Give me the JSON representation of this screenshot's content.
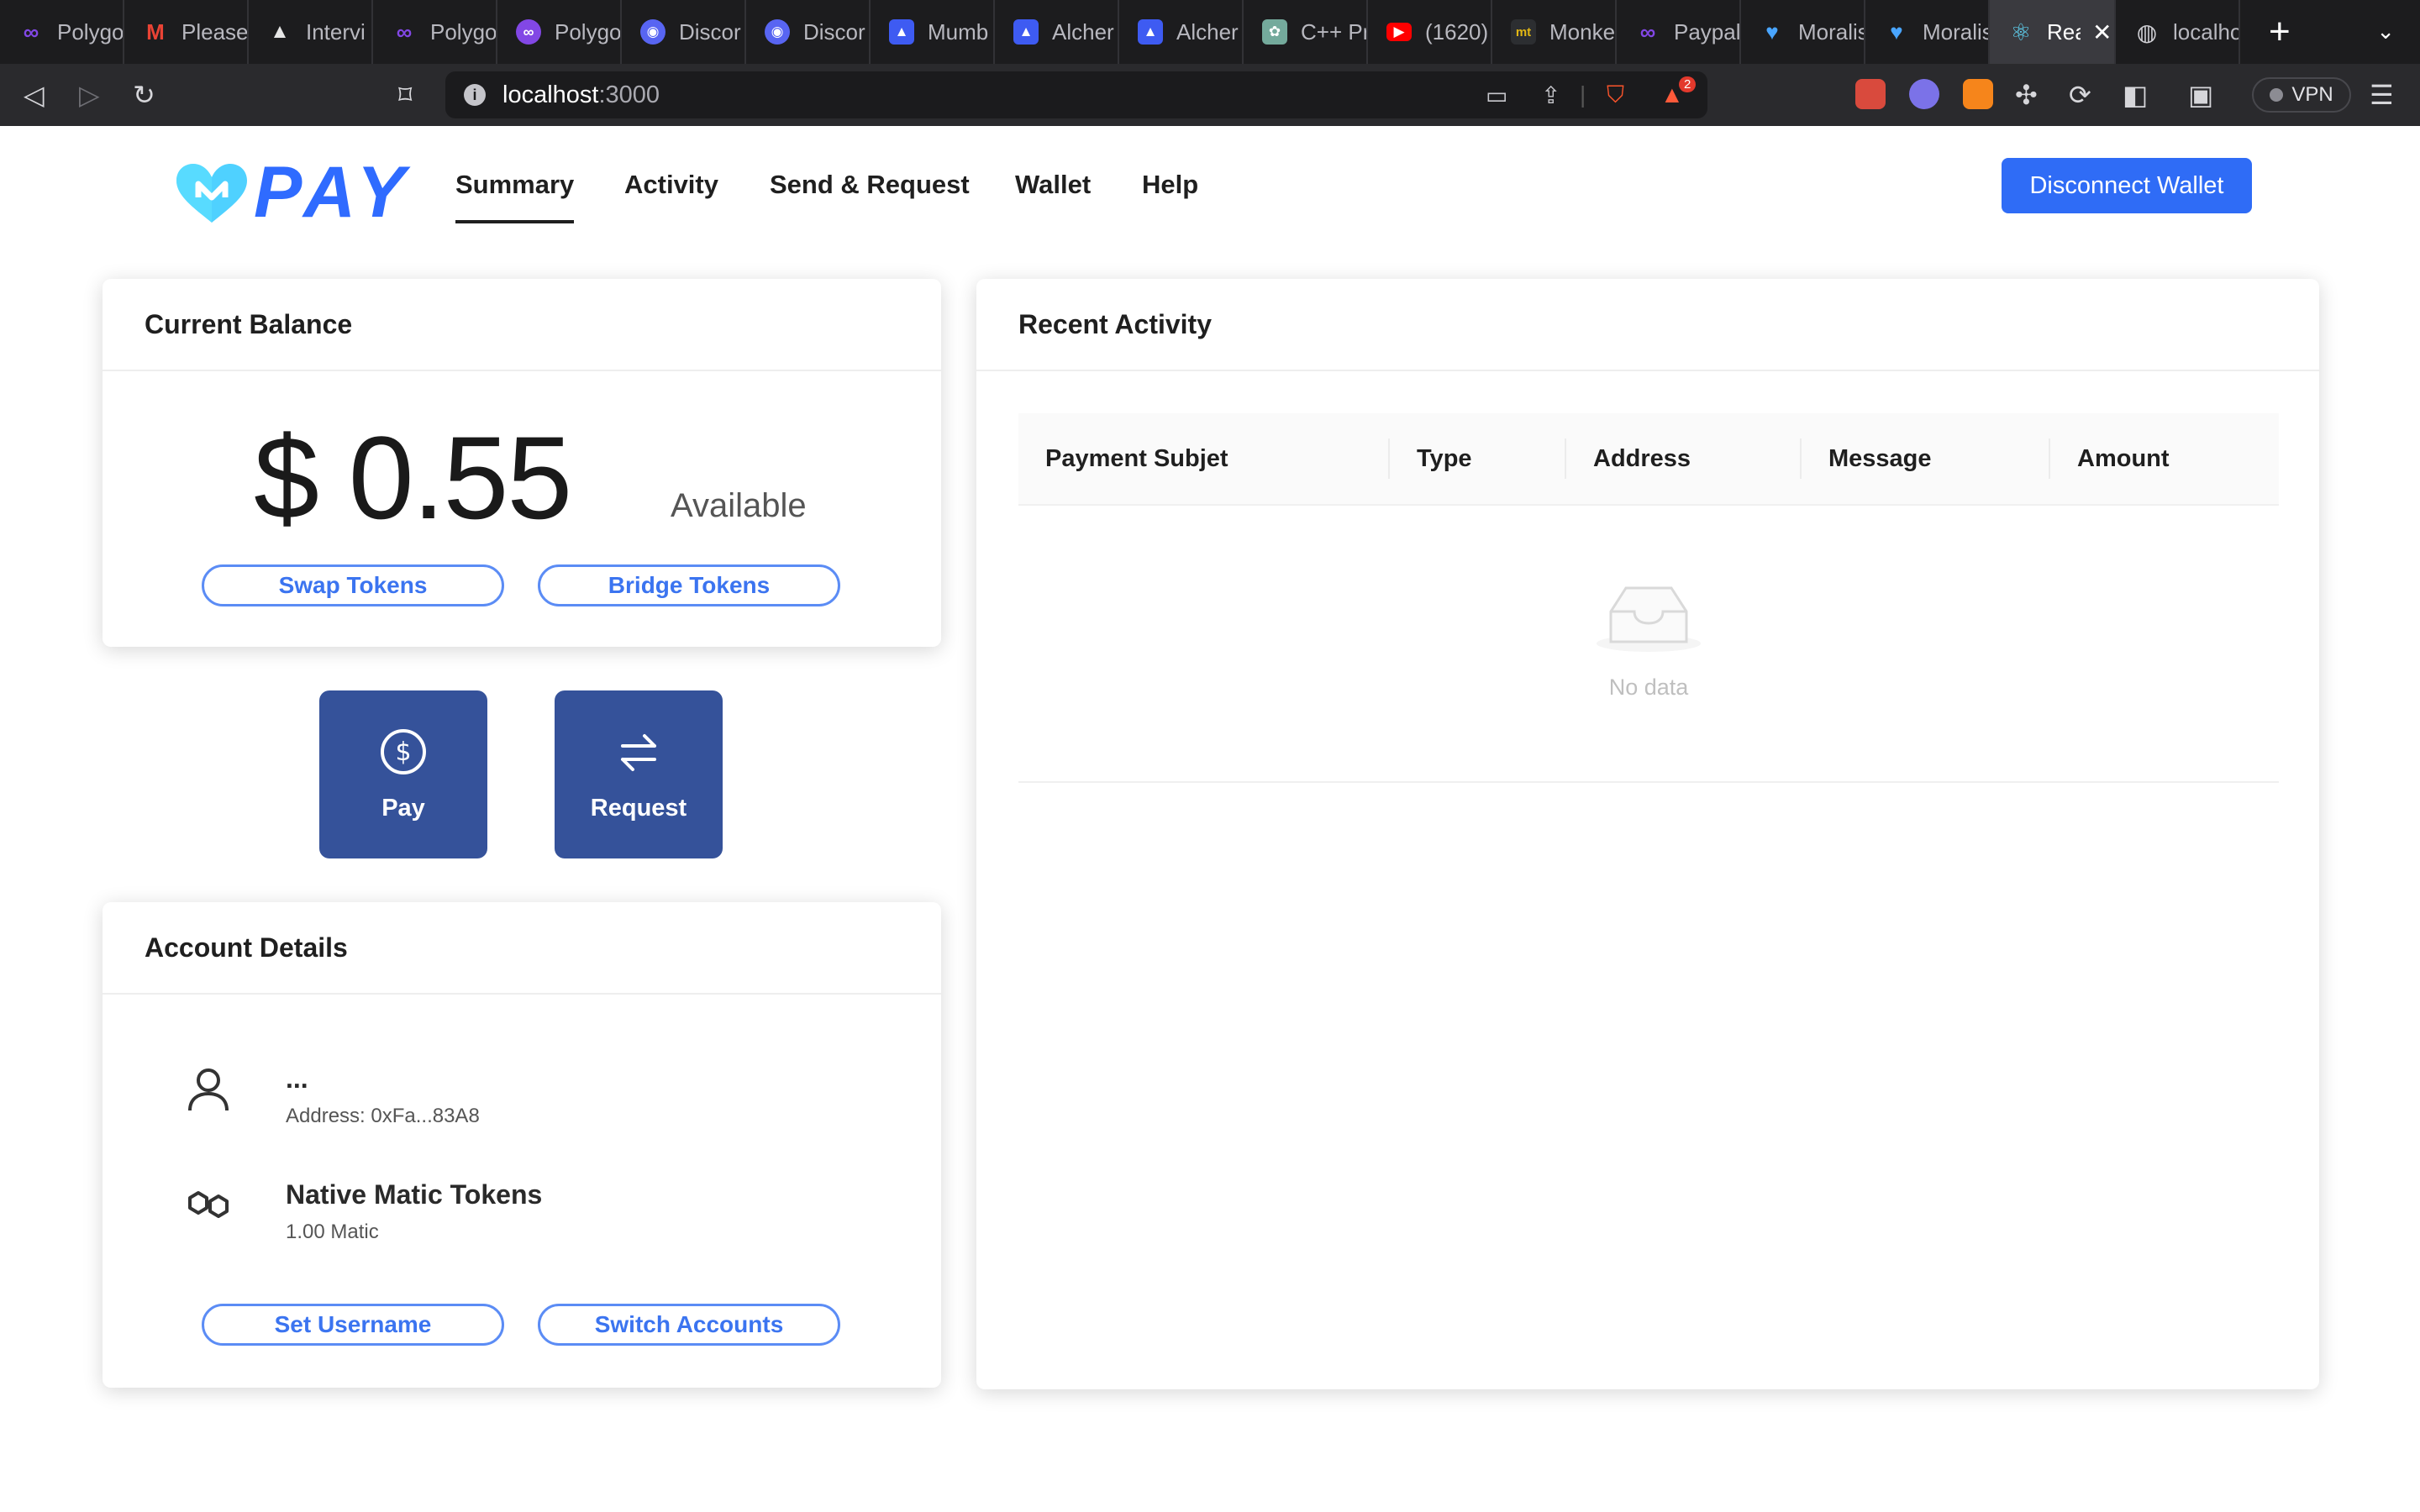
{
  "browser": {
    "tabs": [
      {
        "title": "Polygo",
        "icon": "polygon-icon",
        "color": "#8247e5"
      },
      {
        "title": "Please",
        "icon": "gmail-icon",
        "color": "#ea4335"
      },
      {
        "title": "Intervi",
        "icon": "mountain-icon",
        "color": "#e6e6e6"
      },
      {
        "title": "Polygo",
        "icon": "polygon-icon",
        "color": "#8247e5"
      },
      {
        "title": "Polygo",
        "icon": "polygon-icon",
        "color": "#8247e5"
      },
      {
        "title": "Discor",
        "icon": "discord-icon",
        "color": "#5865f2"
      },
      {
        "title": "Discor",
        "icon": "discord-icon",
        "color": "#5865f2"
      },
      {
        "title": "Mumb",
        "icon": "alchemy-icon",
        "color": "#3e5bf2"
      },
      {
        "title": "Alcher",
        "icon": "alchemy-icon",
        "color": "#3e5bf2"
      },
      {
        "title": "Alcher",
        "icon": "alchemy-icon",
        "color": "#3e5bf2"
      },
      {
        "title": "C++ Pr",
        "icon": "openai-icon",
        "color": "#74aa9c"
      },
      {
        "title": "(1620)",
        "icon": "youtube-icon",
        "color": "#ff0000"
      },
      {
        "title": "Monke",
        "icon": "monkeytype-icon",
        "color": "#2c2e31"
      },
      {
        "title": "Paypal",
        "icon": "polygon-icon",
        "color": "#8247e5"
      },
      {
        "title": "Moralis",
        "icon": "moralis-icon",
        "color": "#49a5ff"
      },
      {
        "title": "Moralis",
        "icon": "moralis-icon",
        "color": "#49a5ff"
      },
      {
        "title": "Rea",
        "icon": "react-icon",
        "color": "#61dafb",
        "active": true
      },
      {
        "title": "localho",
        "icon": "globe-icon",
        "color": "#cfcfd4"
      }
    ],
    "new_tab": "+",
    "url_host": "localhost",
    "url_port": ":3000",
    "brave_badge": "2",
    "vpn_label": "VPN"
  },
  "app": {
    "logo_text": "PAY",
    "nav": [
      "Summary",
      "Activity",
      "Send & Request",
      "Wallet",
      "Help"
    ],
    "active_nav": "Summary",
    "disconnect": "Disconnect Wallet"
  },
  "balance_card": {
    "title": "Current Balance",
    "amount": "$ 0.55",
    "available": "Available",
    "swap": "Swap Tokens",
    "bridge": "Bridge Tokens"
  },
  "actions": {
    "pay": "Pay",
    "request": "Request"
  },
  "account_card": {
    "title": "Account Details",
    "username": "...",
    "address": "Address: 0xFa...83A8",
    "token_name": "Native Matic Tokens",
    "token_amount": "1.00 Matic",
    "set_username": "Set Username",
    "switch_accounts": "Switch Accounts"
  },
  "activity_card": {
    "title": "Recent Activity",
    "columns": [
      "Payment Subjet",
      "Type",
      "Address",
      "Message",
      "Amount"
    ],
    "empty_text": "No data"
  },
  "colors": {
    "primary": "#2f6cf6",
    "action": "#35529a",
    "logo_blue": "#2f6bff",
    "logo_cyan": "#4fd1ff"
  }
}
